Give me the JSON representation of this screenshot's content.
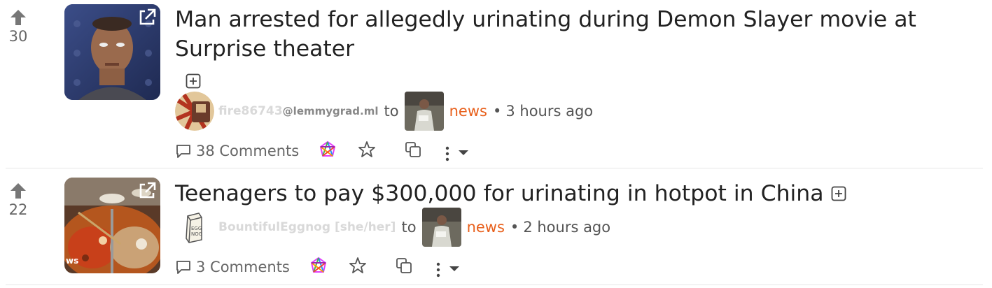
{
  "posts": [
    {
      "score": "30",
      "title": "Man arrested for allegedly urinating during Demon Slayer movie at Surprise theater",
      "user": "fire86743",
      "user_instance": "@lemmygrad.ml",
      "to_label": "to",
      "community": "news",
      "dot": "•",
      "time": "3 hours ago",
      "comments_label": "38 Comments"
    },
    {
      "score": "22",
      "title": "Teenagers to pay $300,000 for urinating in hotpot in China",
      "user": "BountifulEggnog [she/her]",
      "to_label": "to",
      "community": "news",
      "dot": "•",
      "time": "2 hours ago",
      "comments_label": "3 Comments",
      "thumbnail_caption": "ws"
    }
  ],
  "colors": {
    "community": "#e8601c",
    "muted_text": "#666666",
    "username": "#d9d9d9"
  },
  "icons": [
    "upvote-arrow-icon",
    "external-link-icon",
    "expand-plus-icon",
    "comment-icon",
    "cross-post-icon",
    "star-icon",
    "copy-icon",
    "more-icon",
    "chevron-down-icon"
  ]
}
